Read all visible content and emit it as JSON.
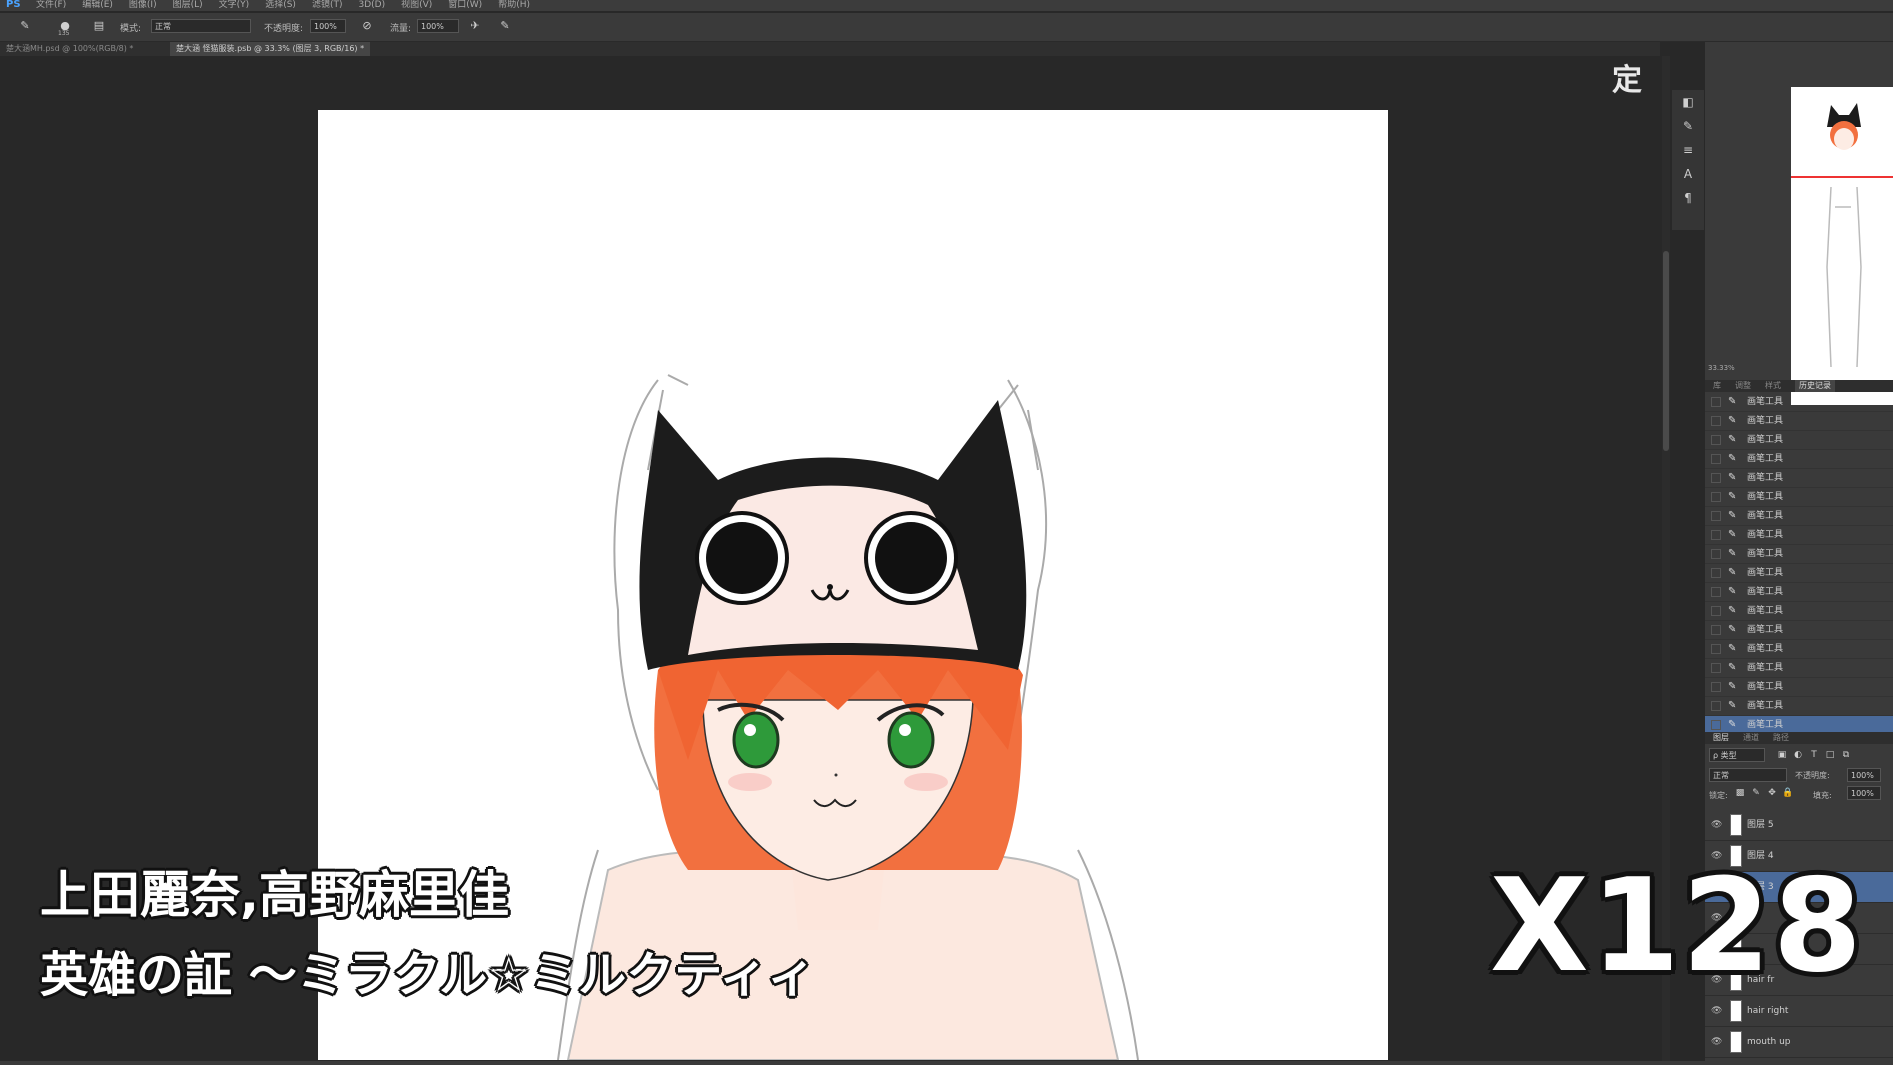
{
  "app": {
    "logo": "PS"
  },
  "menu": [
    "文件(F)",
    "编辑(E)",
    "图像(I)",
    "图层(L)",
    "文字(Y)",
    "选择(S)",
    "滤镜(T)",
    "3D(D)",
    "视图(V)",
    "窗口(W)",
    "帮助(H)"
  ],
  "options": {
    "brush_size": "135",
    "mode_label": "模式:",
    "mode_value": "正常",
    "opacity_label": "不透明度:",
    "opacity_value": "100%",
    "flow_label": "流量:",
    "flow_value": "100%"
  },
  "tabs": [
    {
      "label": "楚大涵MH.psd @ 100%(RGB/8) *"
    },
    {
      "label": "楚大涵 怪猫服装.psb @ 33.3% (图层 3, RGB/16) *"
    }
  ],
  "stamp": "定",
  "navigator": {
    "zoom": "33.33%"
  },
  "panel_tabs": [
    "库",
    "调整",
    "样式",
    "历史记录"
  ],
  "history": {
    "items": [
      "画笔工具",
      "画笔工具",
      "画笔工具",
      "画笔工具",
      "画笔工具",
      "画笔工具",
      "画笔工具",
      "画笔工具",
      "画笔工具",
      "画笔工具",
      "画笔工具",
      "画笔工具",
      "画笔工具",
      "画笔工具",
      "画笔工具",
      "画笔工具",
      "画笔工具",
      "画笔工具"
    ]
  },
  "layer_panel": {
    "tabs": [
      "图层",
      "通道",
      "路径"
    ],
    "filter_label": "ρ 类型",
    "blend_mode": "正常",
    "opacity_label": "不透明度:",
    "opacity_value": "100%",
    "lock_label": "锁定:",
    "fill_label": "填充:",
    "fill_value": "100%",
    "layers": [
      "图层 5",
      "图层 4",
      "图层 3",
      "",
      "",
      "hair fr",
      "hair right",
      "mouth up"
    ]
  },
  "captions": {
    "artists": "上田麗奈,高野麻里佳",
    "song": "英雄の証 ～ミラクル☆ミルクティィ"
  },
  "speed": "X128",
  "colors": {
    "hair": "#f2703f",
    "eyes": "#2e9a3a",
    "hat": "#1c1c1c",
    "selection": "#4a6a9a"
  }
}
